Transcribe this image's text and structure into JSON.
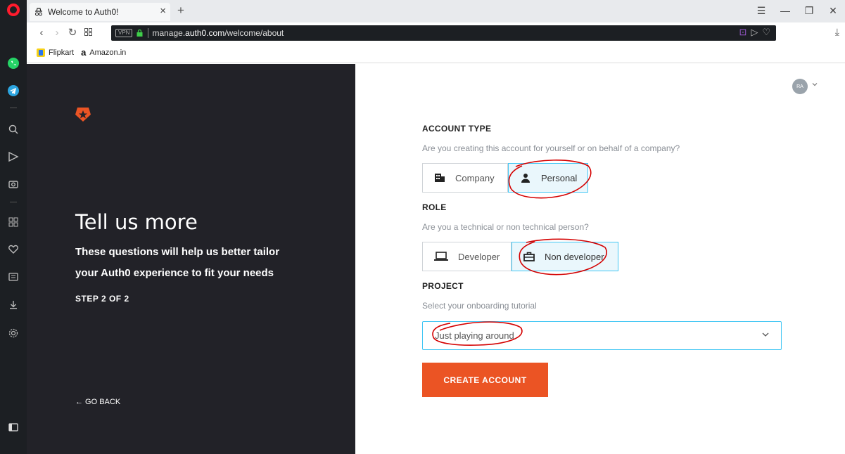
{
  "browser": {
    "tab_title": "Welcome to Auth0!",
    "tab_close": "×",
    "new_tab": "+",
    "url_prefix": "manage.",
    "url_domain": "auth0.com",
    "url_path": "/welcome/about",
    "vpn_label": "VPN",
    "bookmarks": [
      {
        "label": "Flipkart"
      },
      {
        "label": "Amazon.in"
      }
    ]
  },
  "left_panel": {
    "title": "Tell us more",
    "description": "These questions will help us better tailor your Auth0 experience to fit your needs",
    "step": "STEP 2 OF 2",
    "back": "← GO BACK"
  },
  "user": {
    "avatar_initials": "RA"
  },
  "form": {
    "account_type": {
      "label": "ACCOUNT TYPE",
      "hint": "Are you creating this account for yourself or on behalf of a company?",
      "options": [
        "Company",
        "Personal"
      ],
      "selected": "Personal"
    },
    "role": {
      "label": "ROLE",
      "hint": "Are you a technical or non technical person?",
      "options": [
        "Developer",
        "Non developer"
      ],
      "selected": "Non developer"
    },
    "project": {
      "label": "PROJECT",
      "hint": "Select your onboarding tutorial",
      "selected": "Just playing around"
    },
    "submit_label": "CREATE ACCOUNT"
  },
  "colors": {
    "accent": "#eb5424",
    "selected_border": "#44c7f4",
    "selected_bg": "#eaf7fc",
    "dark_panel": "#222228",
    "annotation": "#d40000"
  }
}
